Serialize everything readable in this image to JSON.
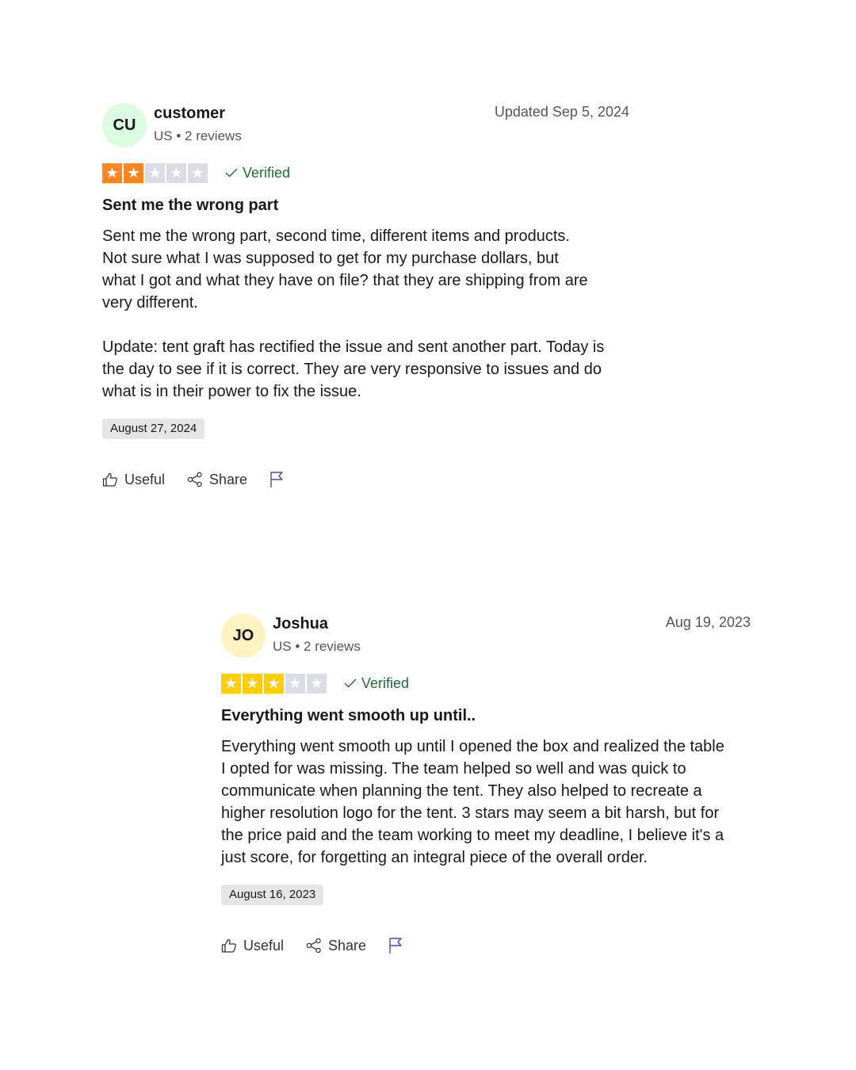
{
  "reviews": [
    {
      "avatar_initials": "CU",
      "avatar_color": "#dcfce2",
      "name": "customer",
      "meta": "US • 2 reviews",
      "date": "Updated Sep 5, 2024",
      "rating": 2,
      "star_color": "#ff8622",
      "verified_label": "Verified",
      "title": "Sent me the wrong part",
      "body": "Sent me the wrong part, second time, different items and products.\nNot sure what I was supposed to get for my purchase dollars, but\nwhat I got and what they have on file? that they are shipping from are\nvery different.\n\nUpdate: tent graft has rectified the issue and sent another part. Today is\nthe day to see if it is correct. They are very responsive to issues and do\nwhat is in their power to fix the issue.",
      "experience_date": "August 27, 2024",
      "useful_label": "Useful",
      "share_label": "Share"
    },
    {
      "avatar_initials": "JO",
      "avatar_color": "#fff3c2",
      "name": "Joshua",
      "meta": "US • 2 reviews",
      "date": "Aug 19, 2023",
      "rating": 3,
      "star_color": "#ffce00",
      "verified_label": "Verified",
      "title": "Everything went smooth up until..",
      "body": "Everything went smooth up until I opened the box and realized the table\nI opted for was missing. The team helped so well and was quick to\ncommunicate when planning the tent. They also helped to recreate a\nhigher resolution logo for the tent. 3 stars may seem a bit harsh, but for\nthe price paid and the team working to meet my deadline, I believe it's a\njust score, for forgetting an integral piece of the overall order.",
      "experience_date": "August 16, 2023",
      "useful_label": "Useful",
      "share_label": "Share"
    }
  ],
  "icons": {
    "thumb": "thumbs-up-icon",
    "share": "share-icon",
    "flag": "flag-icon",
    "check": "check-icon",
    "star": "star-icon"
  },
  "colors": {
    "verified": "#1e6b35",
    "star_empty": "#dcdce6",
    "flag": "#4a4aaa"
  }
}
